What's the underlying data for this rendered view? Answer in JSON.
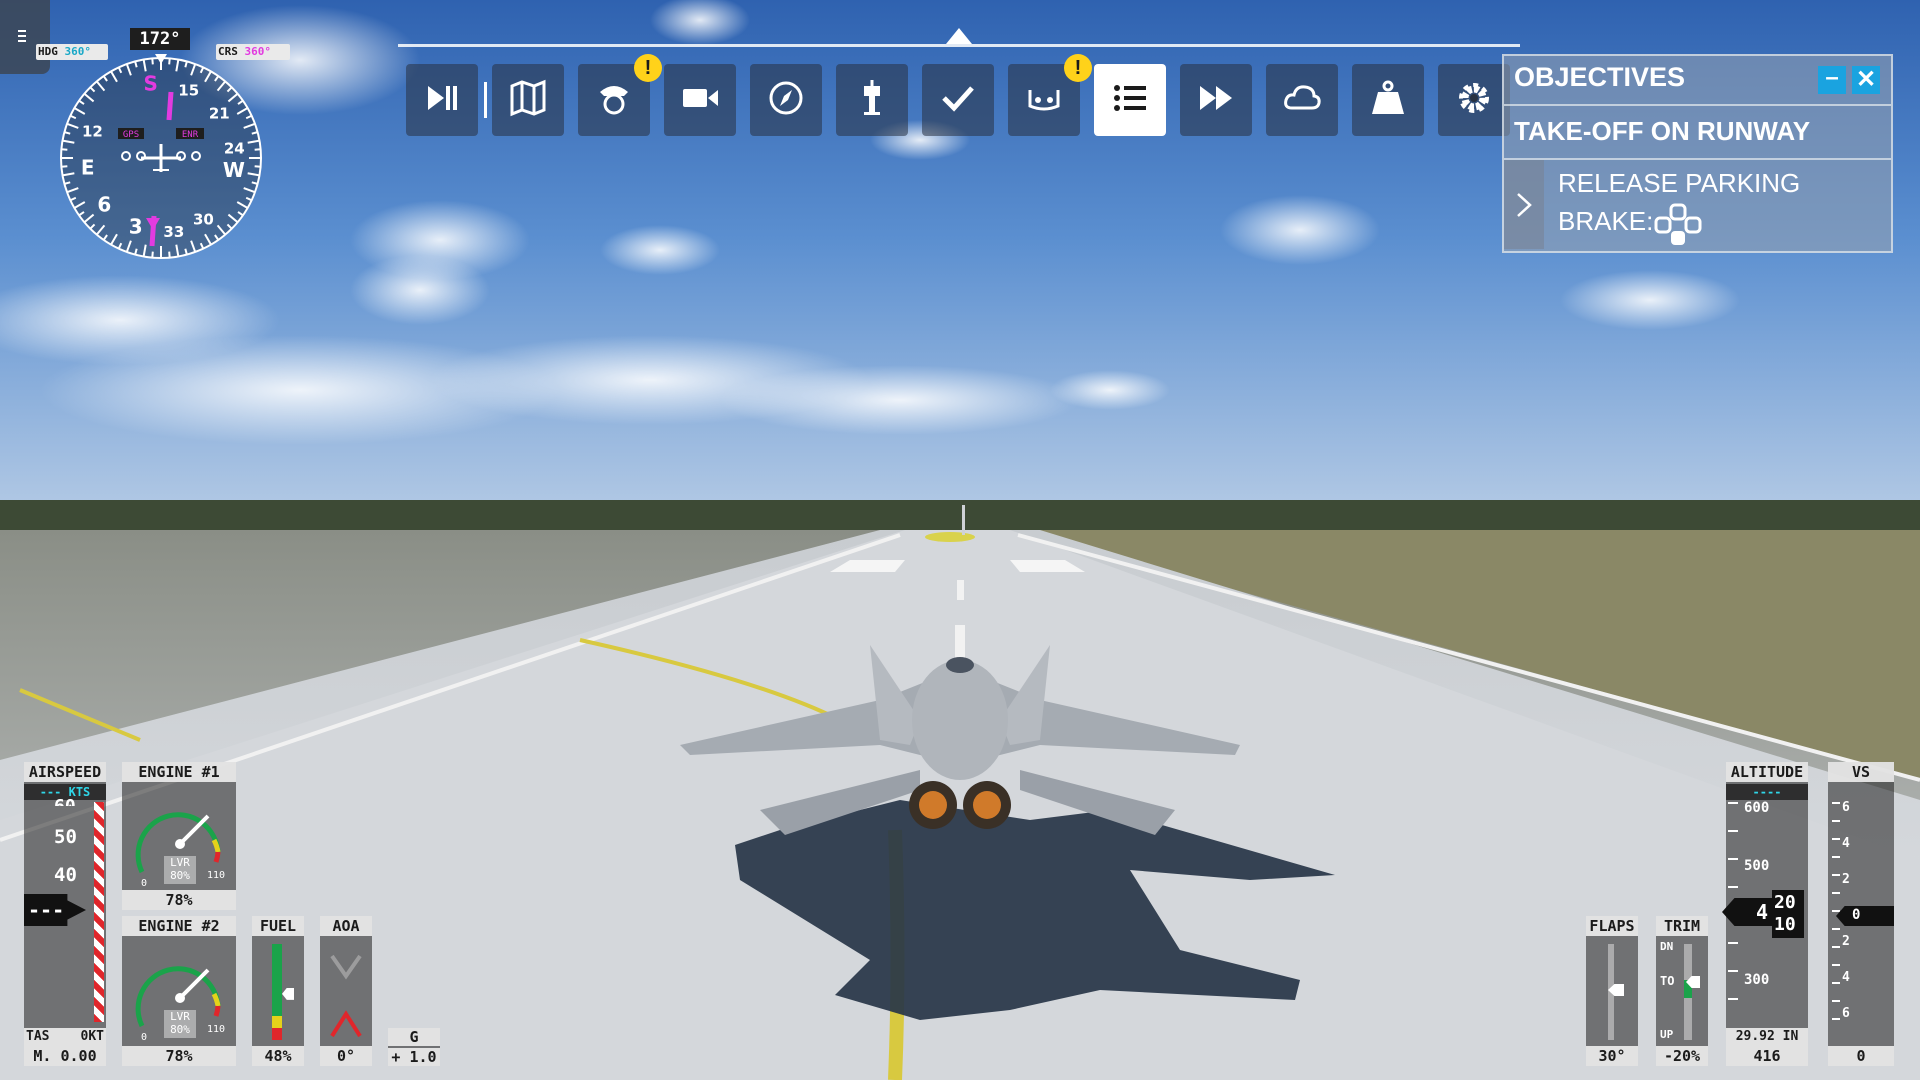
{
  "compass": {
    "heading": "172°",
    "hdg_label": "HDG",
    "hdg_value": "360°",
    "crs_label": "CRS",
    "crs_value": "360°",
    "gps_label": "GPS",
    "enr_label": "ENR",
    "rose_labels": [
      "S",
      "15",
      "21",
      "24",
      "W",
      "30",
      "33",
      "3",
      "E",
      "12",
      "6"
    ]
  },
  "toolbar": {
    "items": [
      {
        "name": "pause-play",
        "active": false
      },
      {
        "name": "map",
        "active": false
      },
      {
        "name": "pilot",
        "active": false,
        "warning": "!"
      },
      {
        "name": "camera",
        "active": false
      },
      {
        "name": "compass",
        "active": false
      },
      {
        "name": "atc-tower",
        "active": false
      },
      {
        "name": "checklist",
        "active": false
      },
      {
        "name": "controls",
        "active": false,
        "warning": "!"
      },
      {
        "name": "objectives",
        "active": true
      },
      {
        "name": "sim-rate",
        "active": false
      },
      {
        "name": "weather",
        "active": false
      },
      {
        "name": "weight-balance",
        "active": false
      },
      {
        "name": "settings",
        "active": false
      }
    ]
  },
  "objectives": {
    "title": "OBJECTIVES",
    "minimize": "–",
    "close": "✕",
    "task": "TAKE-OFF ON RUNWAY",
    "subtask_line1": "RELEASE PARKING",
    "subtask_line2": "BRAKE:"
  },
  "airspeed": {
    "label": "AIRSPEED",
    "unit": "--- KTS",
    "ticks": [
      "60",
      "50",
      "40"
    ],
    "current": "---",
    "tas_label": "TAS",
    "tas_value": "0KT",
    "mach": "M. 0.00"
  },
  "engine1": {
    "label": "ENGINE #1",
    "lvr": "LVR",
    "lvr_value": "80%",
    "min": "0",
    "max": "110",
    "value": "78%",
    "fraction": 0.78
  },
  "engine2": {
    "label": "ENGINE #2",
    "lvr": "LVR",
    "lvr_value": "80%",
    "min": "0",
    "max": "110",
    "value": "78%",
    "fraction": 0.78
  },
  "fuel": {
    "label": "FUEL",
    "value": "48%",
    "level": 0.48
  },
  "aoa": {
    "label": "AOA",
    "value": "0°"
  },
  "g": {
    "label": "G",
    "value": "+ 1.0"
  },
  "flaps": {
    "label": "FLAPS",
    "value": "30°"
  },
  "trim": {
    "label": "TRIM",
    "dn": "DN",
    "to": "TO",
    "up": "UP",
    "value": "-20%"
  },
  "altitude": {
    "label": "ALTITUDE",
    "selected": "----",
    "ticks": [
      "600",
      "500",
      "300"
    ],
    "current_hundreds": "4",
    "current_tens_top": "20",
    "current_tens_bottom": "10",
    "baro": "29.92 IN",
    "value": "416"
  },
  "vs": {
    "label": "VS",
    "ticks": [
      "6",
      "4",
      "2",
      "2",
      "4",
      "6"
    ],
    "current": "0",
    "value": "0"
  },
  "colors": {
    "accent": "#1aa3e0",
    "warning": "#ffd21a",
    "cyan": "#2fd6e8",
    "magenta": "#e23be0"
  }
}
